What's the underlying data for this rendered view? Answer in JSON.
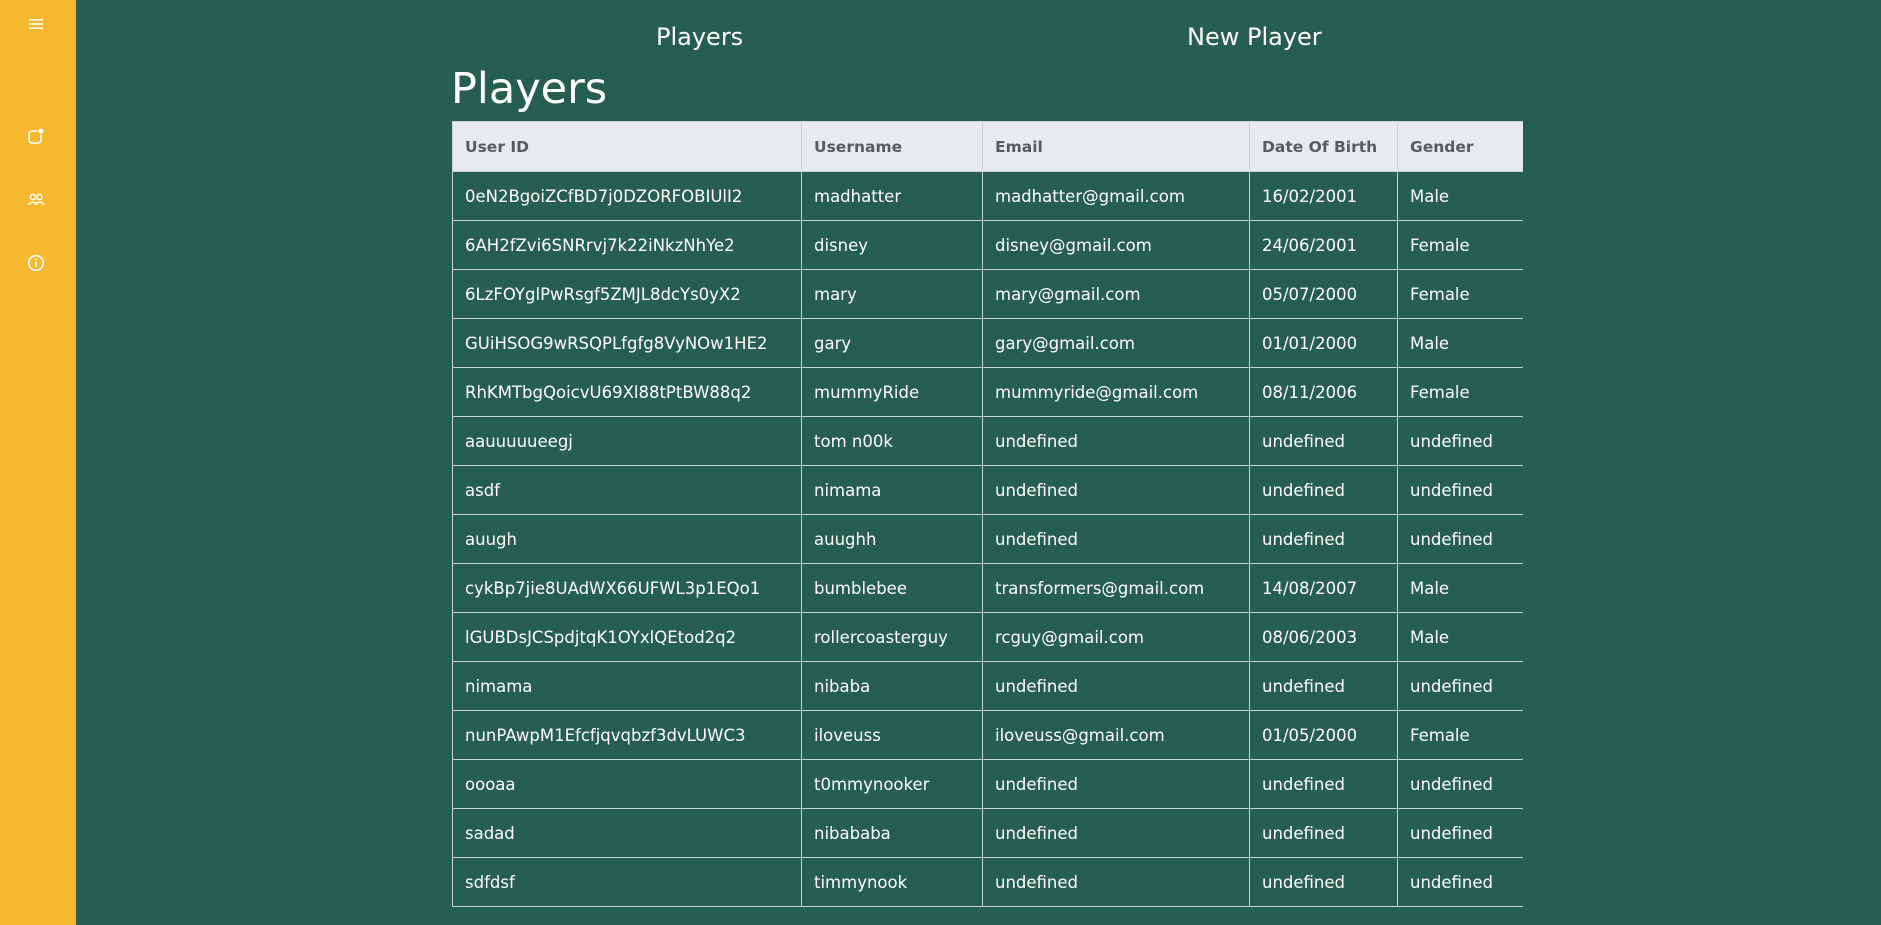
{
  "sidebar": {
    "icons": [
      {
        "name": "menu-icon"
      },
      {
        "name": "notification-icon"
      },
      {
        "name": "users-icon"
      },
      {
        "name": "info-icon"
      }
    ]
  },
  "topnav": {
    "players_label": "Players",
    "new_player_label": "New Player"
  },
  "page": {
    "title": "Players"
  },
  "colors": {
    "background": "#265e50",
    "sidebar": "#f5b82e",
    "header_bg": "#e8ebee",
    "header_text": "#555b61",
    "border": "#c9d3d0"
  },
  "table": {
    "headers": [
      "User ID",
      "Username",
      "Email",
      "Date Of Birth",
      "Gender"
    ],
    "rows": [
      [
        "0eN2BgoiZCfBD7j0DZORFOBIUlI2",
        "madhatter",
        "madhatter@gmail.com",
        "16/02/2001",
        "Male"
      ],
      [
        "6AH2fZvi6SNRrvj7k22iNkzNhYe2",
        "disney",
        "disney@gmail.com",
        "24/06/2001",
        "Female"
      ],
      [
        "6LzFOYglPwRsgf5ZMJL8dcYs0yX2",
        "mary",
        "mary@gmail.com",
        "05/07/2000",
        "Female"
      ],
      [
        "GUiHSOG9wRSQPLfgfg8VyNOw1HE2",
        "gary",
        "gary@gmail.com",
        "01/01/2000",
        "Male"
      ],
      [
        "RhKMTbgQoicvU69Xl88tPtBW88q2",
        "mummyRide",
        "mummyride@gmail.com",
        "08/11/2006",
        "Female"
      ],
      [
        "aauuuuueegj",
        "tom n00k",
        "undefined",
        "undefined",
        "undefined"
      ],
      [
        "asdf",
        "nimama",
        "undefined",
        "undefined",
        "undefined"
      ],
      [
        "auugh",
        "auughh",
        "undefined",
        "undefined",
        "undefined"
      ],
      [
        "cykBp7jie8UAdWX66UFWL3p1EQo1",
        "bumblebee",
        "transformers@gmail.com",
        "14/08/2007",
        "Male"
      ],
      [
        "lGUBDsJCSpdjtqK1OYxlQEtod2q2",
        "rollercoasterguy",
        "rcguy@gmail.com",
        "08/06/2003",
        "Male"
      ],
      [
        "nimama",
        "nibaba",
        "undefined",
        "undefined",
        "undefined"
      ],
      [
        "nunPAwpM1Efcfjqvqbzf3dvLUWC3",
        "iloveuss",
        "iloveuss@gmail.com",
        "01/05/2000",
        "Female"
      ],
      [
        "oooaa",
        "t0mmynooker",
        "undefined",
        "undefined",
        "undefined"
      ],
      [
        "sadad",
        "nibababa",
        "undefined",
        "undefined",
        "undefined"
      ],
      [
        "sdfdsf",
        "timmynook",
        "undefined",
        "undefined",
        "undefined"
      ]
    ]
  }
}
